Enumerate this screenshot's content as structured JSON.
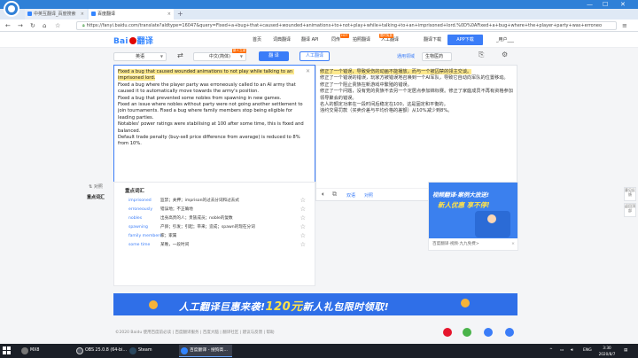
{
  "browser": {
    "tabs": [
      {
        "label": "中英互翻译_百度搜索",
        "fav_color": "#3385ff"
      },
      {
        "label": "百度翻译",
        "fav_color": "#3385ff"
      }
    ],
    "url": "https://fanyi.baidu.com/translate?aldtype=16047&query=Fixed+a+bug+that+caused+wounded+animations+to+not+play+while+talking+to+an+imprisoned+lord.%0D%0AFixed+a+bug+where+the+player+party+was+erroneo"
  },
  "topnav": {
    "logo_left": "Bai",
    "logo_right": "翻译",
    "links": [
      "首页",
      "词典翻译",
      "翻译 API",
      "同传",
      "拍照翻译",
      "人工翻译",
      "翻译下载"
    ],
    "hot_badges": [
      "HOT",
      "限时免费"
    ],
    "app_download": "APP下载",
    "user": "_用户___"
  },
  "toolbar": {
    "source_lang": "英语",
    "target_lang": "中文(简体)",
    "translate_label": "翻 译",
    "human_label": "人工翻译",
    "human_badge": "新人立减",
    "domain_link": "通用领域",
    "field_select": "生物医药"
  },
  "source": {
    "highlighted": "Fixed a bug that caused wounded animations to not play while talking to an imprisoned lord.",
    "rest": "\nFixed a bug where the player party was erroneously called to an AI army that caused it to automatically move towards the army's position.\nFixed a bug that prevented some nobles from spawning in new games.\nFixed an issue where nobles without party were not going another settlement to join tournaments. Fixed a bug where family members stop being eligible for leading parties.\nNotables' power ratings were stabilising at 100 after some time, this is fixed and balanced.\nDefault trade penalty (buy-sell price difference from average) is reduced to 8% from 10%."
  },
  "target": {
    "highlighted": "修正了一个错误，导致受伤的动画不能播放，而与一个被囚禁的领主交谈。",
    "rest": "\n修正了一个错误的错误，玩家方被错误地召唤到一个AI军队，导致它自动向军队的位置移动。\n修正了一个阻止贵族在新游戏中繁殖的错误。\n修正了一个问题，没有党的贵族不去另一个定居点参加锦标赛。修正了家庭成员不再有资格参加领导聚会的错误。\n名人的额定功率在一段时间后稳定在100，这是固定和平衡的。\n违约交易罚款（买卖价差与平均价格的差额）从10%减少到8%。",
    "listen_label": "双语",
    "compare_label": "对照",
    "other_toggle": "其他法规"
  },
  "side_menu": [
    "⇅ 对照",
    "重点词汇"
  ],
  "vocab": {
    "title": "重点词汇",
    "rows": [
      {
        "word": "imprisoned",
        "def": "监禁；关押；imprison的过去分词和过去式"
      },
      {
        "word": "erroneously",
        "def": "错误地；不正确地"
      },
      {
        "word": "nobles",
        "def": "出身高贵的人；贵族成员；noble的复数"
      },
      {
        "word": "spawning",
        "def": "产卵；引发；引起；带来；造成；spawn的现在分词"
      },
      {
        "word": "family members",
        "def": "家；家属"
      },
      {
        "word": "some time",
        "def": "某晚，一段时间"
      }
    ]
  },
  "ad": {
    "title": "视频翻译·案例大放送!",
    "sub": "新人优惠 享不停!",
    "caption": "百度翻译·视频·九九免费>"
  },
  "float_buttons": [
    "意见反馈",
    "返回顶部"
  ],
  "banner": {
    "prefix": "人工翻译巨惠来袭!",
    "amount": "120元",
    "suffix": "新人礼包限时领取!"
  },
  "footer": {
    "text": "©2020 Baidu  使用百度前必读  |  百度翻译服务  |  百度大脑  |  翻译社区  |  建议与反馈  |  帮助"
  },
  "taskbar": {
    "items": [
      {
        "label": "MX8",
        "color": "#777"
      },
      {
        "label": "OBS 25.0.8 (64-bi...",
        "color": "#4a4f5a"
      },
      {
        "label": "Steam",
        "color": "#1b2838"
      },
      {
        "label": "百度翻译 - 搜狗高...",
        "color": "#3385ff"
      }
    ],
    "tray_lang": "ENG",
    "time": "3:30",
    "date": "2020/8/7"
  }
}
